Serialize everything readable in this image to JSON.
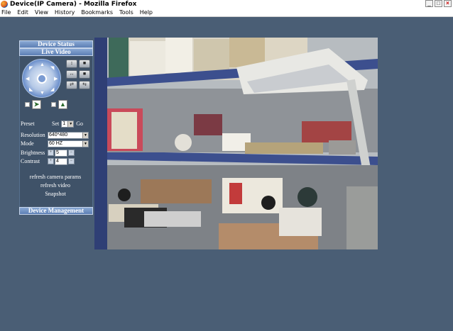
{
  "window": {
    "title": "Device(IP Camera) - Mozilla Firefox",
    "minimize": "_",
    "maximize": "□",
    "close": "×"
  },
  "menu": [
    {
      "label": "File"
    },
    {
      "label": "Edit"
    },
    {
      "label": "View"
    },
    {
      "label": "History"
    },
    {
      "label": "Bookmarks"
    },
    {
      "label": "Tools"
    },
    {
      "label": "Help"
    }
  ],
  "panel": {
    "device_status": "Device Status",
    "live_video": "Live Video",
    "device_management": "Device Management",
    "preset_label": "Preset",
    "preset_set": "Set",
    "preset_value": "1",
    "preset_go": "Go",
    "resolution_label": "Resolution",
    "resolution_value": "640*480",
    "mode_label": "Mode",
    "mode_value": "60 HZ",
    "brightness_label": "Brightness",
    "brightness_value": "5",
    "contrast_label": "Contrast",
    "contrast_value": "4",
    "refresh_camera_params": "refresh camera params",
    "refresh_video": "refresh video",
    "snapshot": "Snapshot"
  },
  "icons": {
    "ptz_up": "arrow-up-icon",
    "ptz_down": "arrow-down-icon",
    "ptz_left": "arrow-left-icon",
    "ptz_right": "arrow-right-icon",
    "ptz_center": "center-icon"
  },
  "colors": {
    "page_background": "#4a5e75",
    "panel_header": "#5d7fb4",
    "panel_body": "#3f5268"
  }
}
